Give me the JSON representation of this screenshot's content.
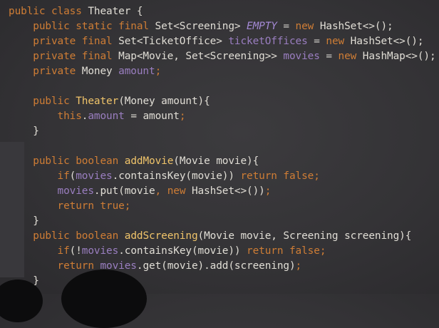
{
  "code": {
    "lines": [
      {
        "indent": "",
        "tokens": [
          {
            "t": "public",
            "c": "kw"
          },
          {
            "t": " ",
            "c": "pl"
          },
          {
            "t": "class",
            "c": "kw"
          },
          {
            "t": " Theater {",
            "c": "ty"
          }
        ]
      },
      {
        "indent": "    ",
        "tokens": [
          {
            "t": "public static final",
            "c": "kw"
          },
          {
            "t": " Set<Screening> ",
            "c": "ty"
          },
          {
            "t": "EMPTY",
            "c": "st"
          },
          {
            "t": " = ",
            "c": "pl"
          },
          {
            "t": "new",
            "c": "kw"
          },
          {
            "t": " HashSet<>();",
            "c": "ty"
          }
        ]
      },
      {
        "indent": "    ",
        "tokens": [
          {
            "t": "private final",
            "c": "kw"
          },
          {
            "t": " Set<TicketOffice> ",
            "c": "ty"
          },
          {
            "t": "ticketOffices",
            "c": "fld"
          },
          {
            "t": " = ",
            "c": "pl"
          },
          {
            "t": "new",
            "c": "kw"
          },
          {
            "t": " HashSet<>();",
            "c": "ty"
          }
        ]
      },
      {
        "indent": "    ",
        "tokens": [
          {
            "t": "private final",
            "c": "kw"
          },
          {
            "t": " Map<Movie, Set<Screening>> ",
            "c": "ty"
          },
          {
            "t": "movies",
            "c": "fld"
          },
          {
            "t": " = ",
            "c": "pl"
          },
          {
            "t": "new",
            "c": "kw"
          },
          {
            "t": " HashMap<>();",
            "c": "ty"
          }
        ]
      },
      {
        "indent": "    ",
        "tokens": [
          {
            "t": "private",
            "c": "kw"
          },
          {
            "t": " Money ",
            "c": "ty"
          },
          {
            "t": "amount",
            "c": "fld"
          },
          {
            "t": ";",
            "c": "pu"
          }
        ]
      },
      {
        "indent": "",
        "tokens": []
      },
      {
        "indent": "    ",
        "tokens": [
          {
            "t": "public",
            "c": "kw"
          },
          {
            "t": " ",
            "c": "pl"
          },
          {
            "t": "Theater",
            "c": "mth"
          },
          {
            "t": "(Money amount){",
            "c": "ty"
          }
        ]
      },
      {
        "indent": "        ",
        "tokens": [
          {
            "t": "this",
            "c": "kw"
          },
          {
            "t": ".",
            "c": "pl"
          },
          {
            "t": "amount",
            "c": "fld"
          },
          {
            "t": " = amount",
            "c": "ty"
          },
          {
            "t": ";",
            "c": "pu"
          }
        ]
      },
      {
        "indent": "    ",
        "tokens": [
          {
            "t": "}",
            "c": "ty"
          }
        ]
      },
      {
        "indent": "",
        "tokens": []
      },
      {
        "indent": "    ",
        "tokens": [
          {
            "t": "public boolean",
            "c": "kw"
          },
          {
            "t": " ",
            "c": "pl"
          },
          {
            "t": "addMovie",
            "c": "mth"
          },
          {
            "t": "(Movie movie){",
            "c": "ty"
          }
        ]
      },
      {
        "indent": "        ",
        "tokens": [
          {
            "t": "if",
            "c": "kw"
          },
          {
            "t": "(",
            "c": "ty"
          },
          {
            "t": "movies",
            "c": "fld"
          },
          {
            "t": ".containsKey(movie)) ",
            "c": "ty"
          },
          {
            "t": "return false",
            "c": "kw"
          },
          {
            "t": ";",
            "c": "pu"
          }
        ]
      },
      {
        "indent": "        ",
        "tokens": [
          {
            "t": "movies",
            "c": "fld"
          },
          {
            "t": ".put(movie",
            "c": "ty"
          },
          {
            "t": ",",
            "c": "pu"
          },
          {
            "t": " ",
            "c": "pl"
          },
          {
            "t": "new",
            "c": "kw"
          },
          {
            "t": " HashSet<>())",
            "c": "ty"
          },
          {
            "t": ";",
            "c": "pu"
          }
        ]
      },
      {
        "indent": "        ",
        "tokens": [
          {
            "t": "return true",
            "c": "kw"
          },
          {
            "t": ";",
            "c": "pu"
          }
        ]
      },
      {
        "indent": "    ",
        "tokens": [
          {
            "t": "}",
            "c": "ty"
          }
        ]
      },
      {
        "indent": "    ",
        "tokens": [
          {
            "t": "public boolean",
            "c": "kw"
          },
          {
            "t": " ",
            "c": "pl"
          },
          {
            "t": "addScreening",
            "c": "mth"
          },
          {
            "t": "(Movie movie, Screening screening){",
            "c": "ty"
          }
        ]
      },
      {
        "indent": "        ",
        "tokens": [
          {
            "t": "if",
            "c": "kw"
          },
          {
            "t": "(!",
            "c": "ty"
          },
          {
            "t": "movies",
            "c": "fld"
          },
          {
            "t": ".containsKey(movie)) ",
            "c": "ty"
          },
          {
            "t": "return false",
            "c": "kw"
          },
          {
            "t": ";",
            "c": "pu"
          }
        ]
      },
      {
        "indent": "        ",
        "tokens": [
          {
            "t": "return",
            "c": "kw"
          },
          {
            "t": " ",
            "c": "pl"
          },
          {
            "t": "movies",
            "c": "fld"
          },
          {
            "t": ".get(movie).add(screening)",
            "c": "ty"
          },
          {
            "t": ";",
            "c": "pu"
          }
        ]
      },
      {
        "indent": "    ",
        "tokens": [
          {
            "t": "}",
            "c": "ty"
          }
        ]
      }
    ]
  },
  "colors": {
    "background": "#343336",
    "keyword": "#cf7d35",
    "type": "#e0ddd5",
    "field": "#9a7ec0",
    "static": "#a58ad6",
    "method": "#f0c46a"
  }
}
